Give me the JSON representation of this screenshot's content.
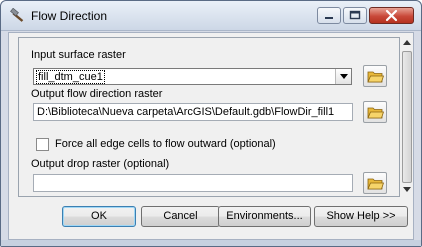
{
  "window": {
    "title": "Flow Direction",
    "title_icon": "hammer-icon"
  },
  "form": {
    "input_surface_label": "Input surface raster",
    "input_surface_value": "fill_dtm_cue1",
    "output_flow_label": "Output flow direction raster",
    "output_flow_value": "D:\\Biblioteca\\Nueva carpeta\\ArcGIS\\Default.gdb\\FlowDir_fill1",
    "force_edge_label": "Force all edge cells to flow outward (optional)",
    "force_edge_checked": false,
    "output_drop_label": "Output drop raster (optional)",
    "output_drop_value": ""
  },
  "buttons": {
    "ok": "OK",
    "cancel": "Cancel",
    "environments": "Environments...",
    "show_help": "Show Help >>"
  },
  "colors": {
    "folder_icon": "#e8b83a",
    "close_button": "#c9493a"
  }
}
